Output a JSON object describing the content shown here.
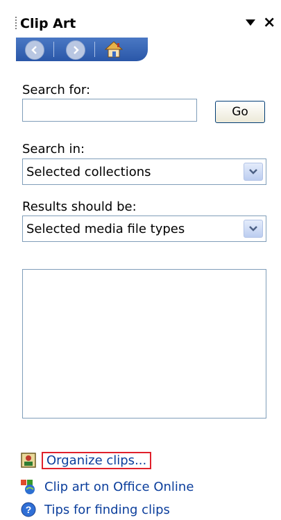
{
  "panel": {
    "title": "Clip Art",
    "search_label": "Search for:",
    "search_value": "",
    "go_label": "Go",
    "search_in_label": "Search in:",
    "search_in_value": "Selected collections",
    "results_label": "Results should be:",
    "results_value": "Selected media file types"
  },
  "links": {
    "organize": "Organize clips...",
    "online": "Clip art on Office Online",
    "tips": "Tips for finding clips"
  },
  "icons": {
    "back": "back-arrow-icon",
    "forward": "forward-arrow-icon",
    "home": "home-icon",
    "dropdown": "chevron-down-icon"
  },
  "colors": {
    "nav_bar": "#2a57a8",
    "link_text": "#0b3e9c",
    "highlight_border": "#e0202b",
    "border": "#7f9db9"
  }
}
